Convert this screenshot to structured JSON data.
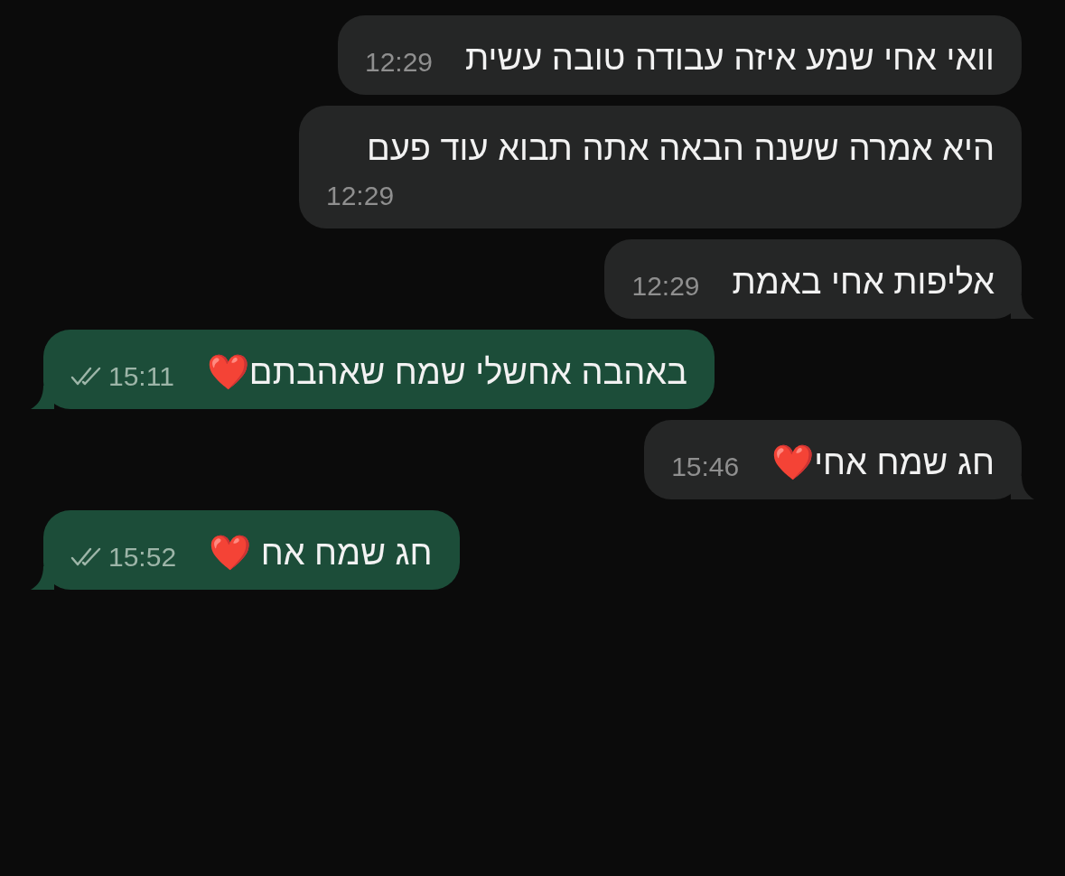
{
  "messages": [
    {
      "kind": "incoming",
      "text": "וואי אחי שמע איזה עבודה טובה עשית",
      "time": "12:29",
      "tail": false
    },
    {
      "kind": "incoming",
      "text": "היא אמרה ששנה הבאה אתה תבוא עוד פעם",
      "time": "12:29",
      "tail": false
    },
    {
      "kind": "incoming",
      "text": "אליפות אחי באמת",
      "time": "12:29",
      "tail": true
    },
    {
      "kind": "outgoing",
      "text": "באהבה אחשלי שמח שאהבתם❤️",
      "time": "15:11",
      "read": true,
      "tail": true
    },
    {
      "kind": "incoming",
      "text": "חג שמח אחי❤️",
      "time": "15:46",
      "tail": true
    },
    {
      "kind": "outgoing",
      "text": "חג שמח אח ❤️",
      "time": "15:52",
      "read": true,
      "tail": true
    }
  ]
}
